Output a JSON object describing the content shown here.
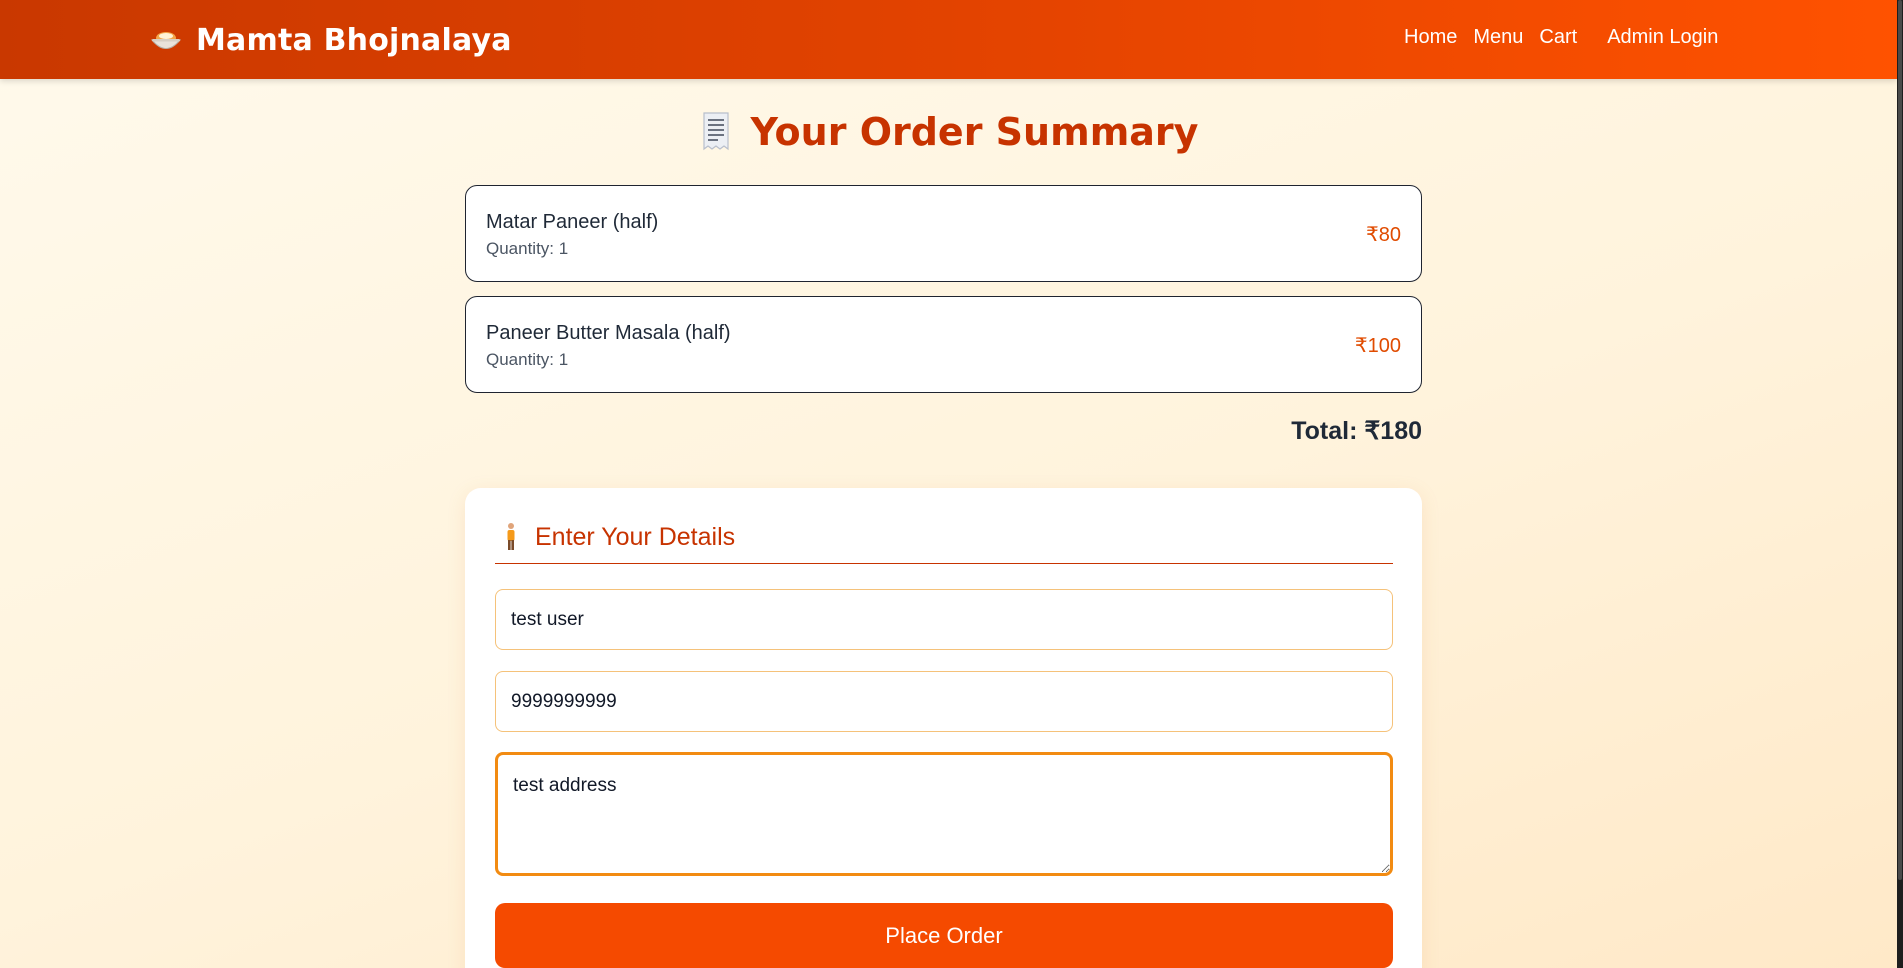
{
  "header": {
    "brand_name": "Mamta Bhojnalaya",
    "brand_icon": "food-bowl-icon",
    "nav": {
      "home": "Home",
      "menu": "Menu",
      "cart": "Cart",
      "admin": "Admin Login"
    },
    "gradient_colors": [
      "#c93800",
      "#ff5200"
    ]
  },
  "page": {
    "title": "Your Order Summary",
    "title_icon": "receipt-icon"
  },
  "order": {
    "items": [
      {
        "name": "Matar Paneer (half)",
        "quantity": "Quantity: 1",
        "price": "₹80"
      },
      {
        "name": "Paneer Butter Masala (half)",
        "quantity": "Quantity: 1",
        "price": "₹100"
      }
    ],
    "total": "Total: ₹180"
  },
  "details": {
    "title": "Enter Your Details",
    "title_icon": "person-icon",
    "name_value": "test user",
    "phone_value": "9999999999",
    "address_value": "test address",
    "submit_label": "Place Order"
  },
  "colors": {
    "accent": "#c73300",
    "button": "#f54a00",
    "price": "#e04b00",
    "focus_border": "#f28b12"
  }
}
